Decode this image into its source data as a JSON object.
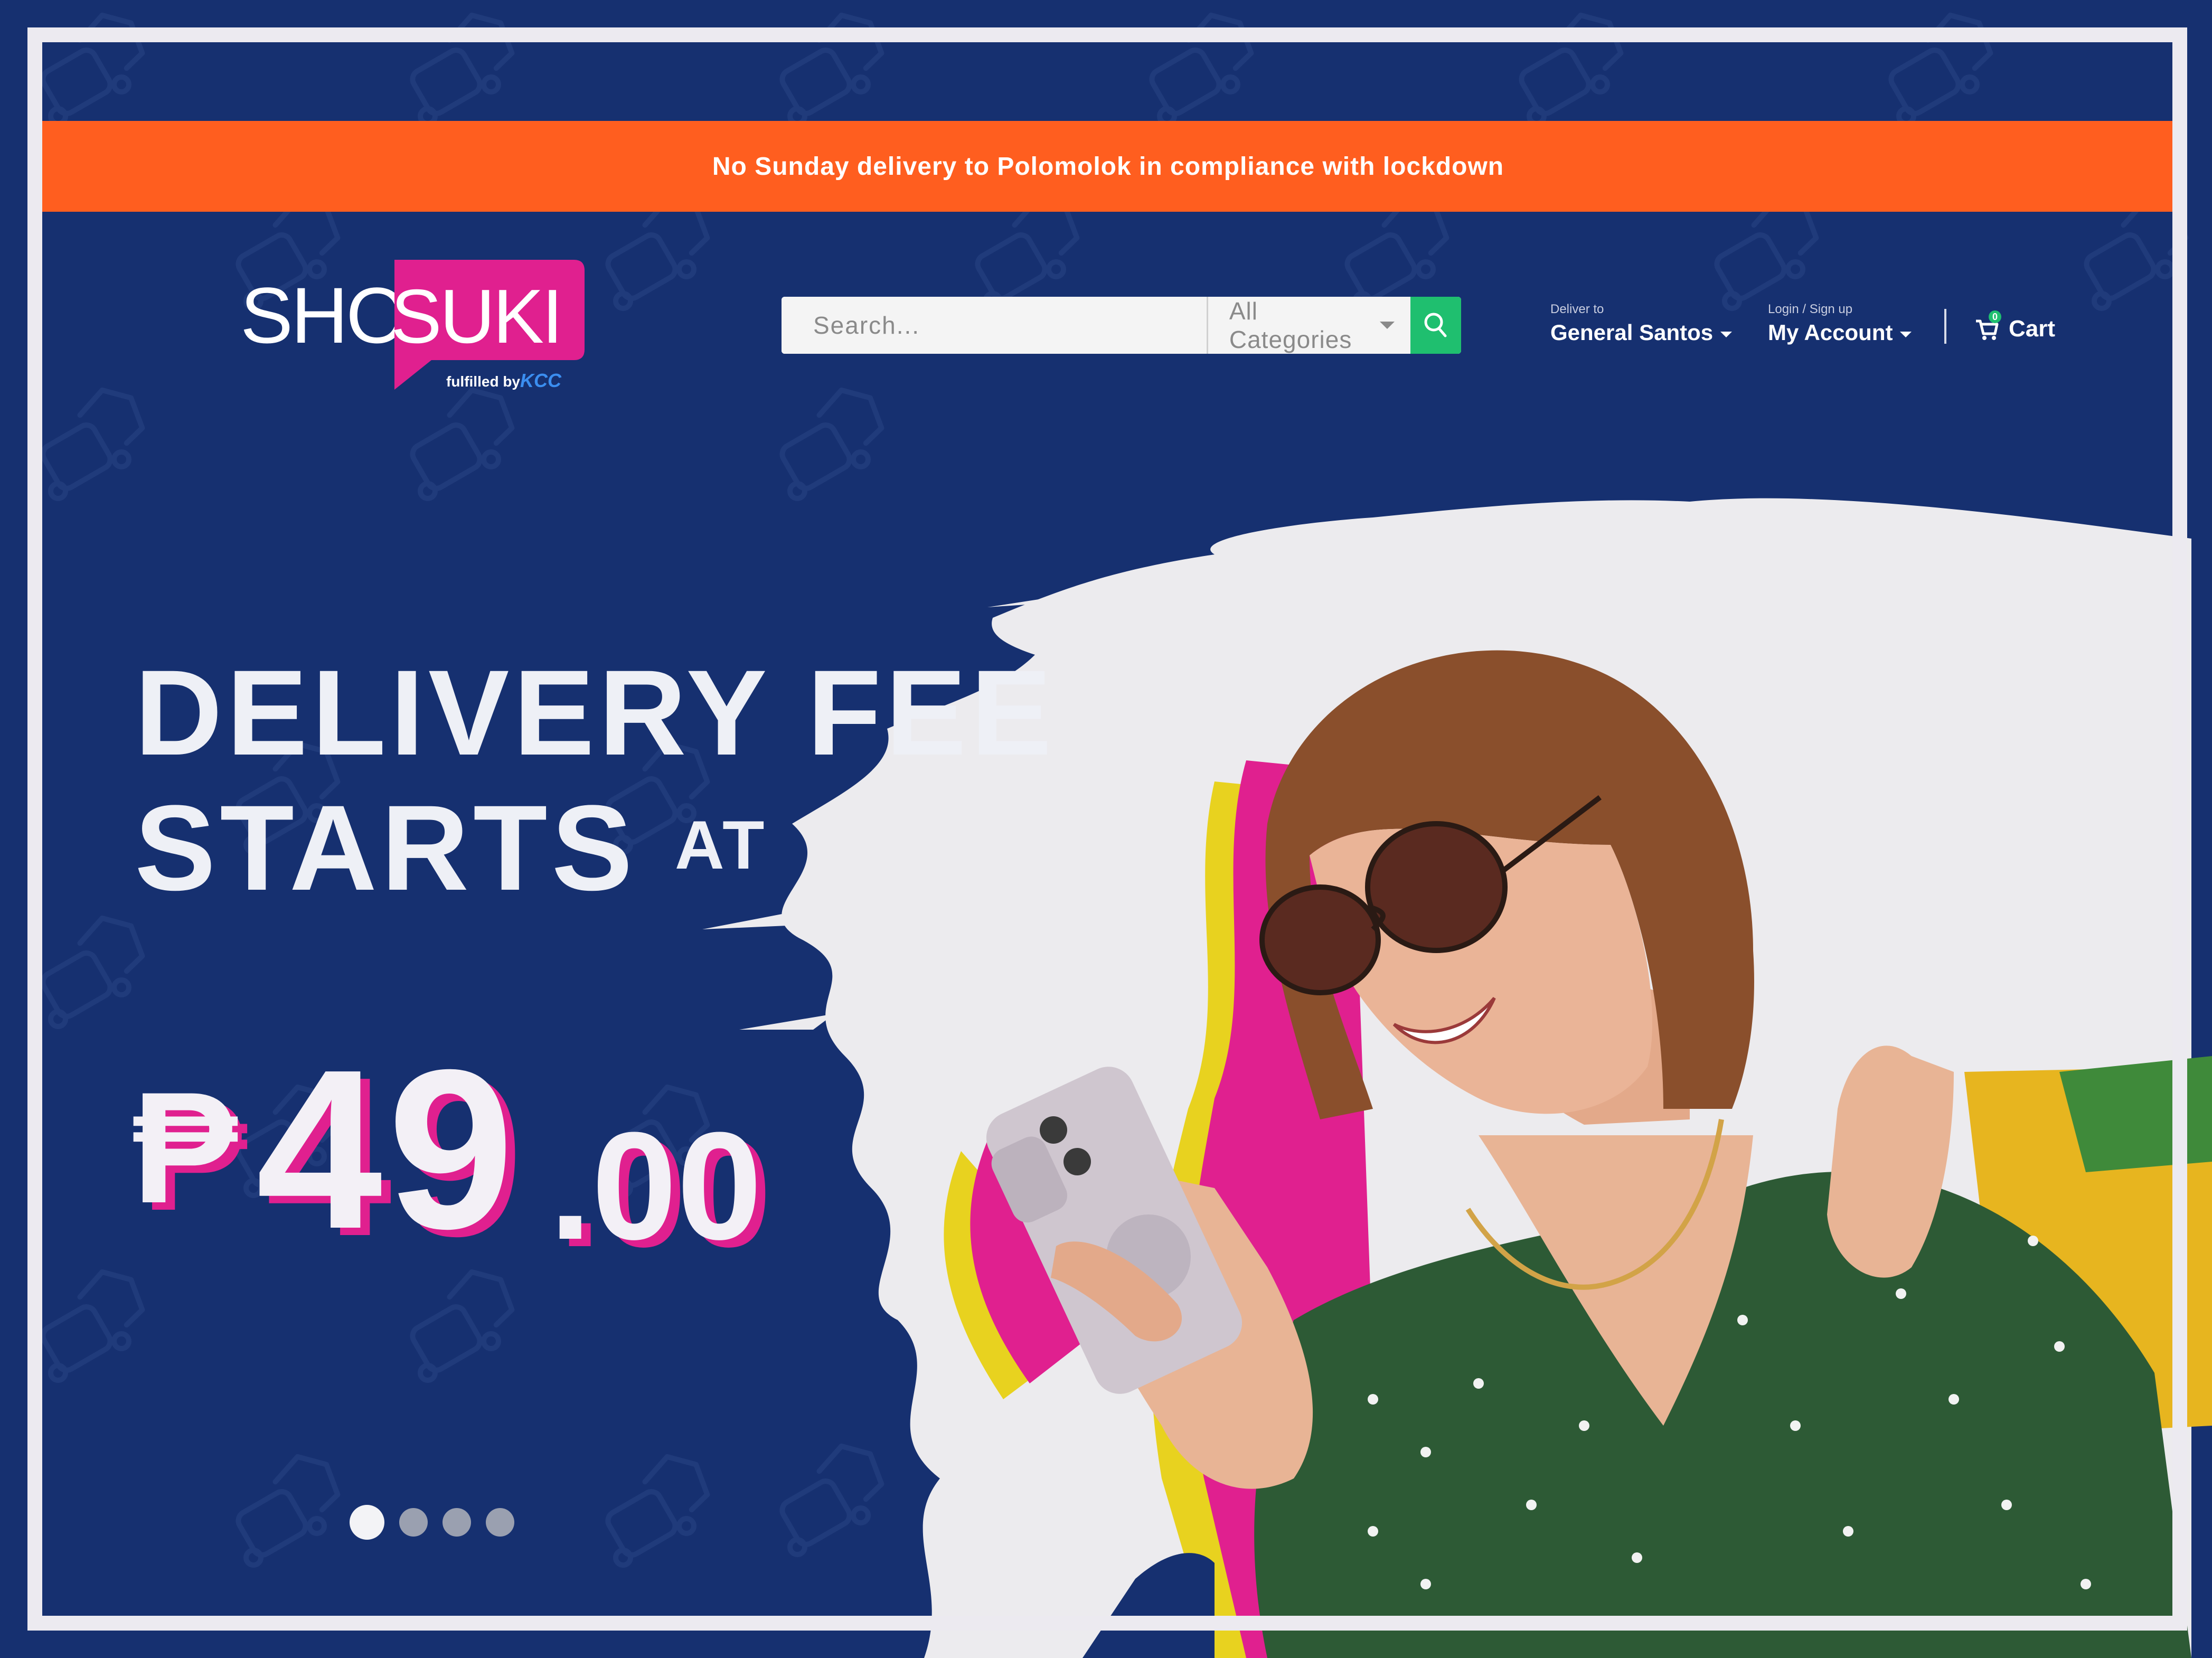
{
  "announcement": {
    "text": "No Sunday delivery to Polomolok in compliance with lockdown"
  },
  "logo": {
    "shop": "SHOP",
    "suki": "SUKI",
    "fulfilled": "fulfilled by",
    "partner": "KCC"
  },
  "search": {
    "placeholder": "Search...",
    "category": "All Categories",
    "button_icon": "search-icon"
  },
  "deliver": {
    "label": "Deliver to",
    "value": "General Santos"
  },
  "account": {
    "label": "Login / Sign up",
    "value": "My Account"
  },
  "cart": {
    "label": "Cart",
    "count": "0"
  },
  "hero": {
    "line1": "DELIVERY FEE",
    "line2": "STARTS",
    "line2_suffix": "AT",
    "currency": "₱",
    "price_int": "49",
    "price_dec": ".00",
    "slides": 4,
    "active_slide": 1
  },
  "colors": {
    "background": "#163070",
    "announcement": "#ff5e1f",
    "brand_pink": "#e0208f",
    "accent_green": "#1fbf6f",
    "frame": "#eceaf0"
  }
}
